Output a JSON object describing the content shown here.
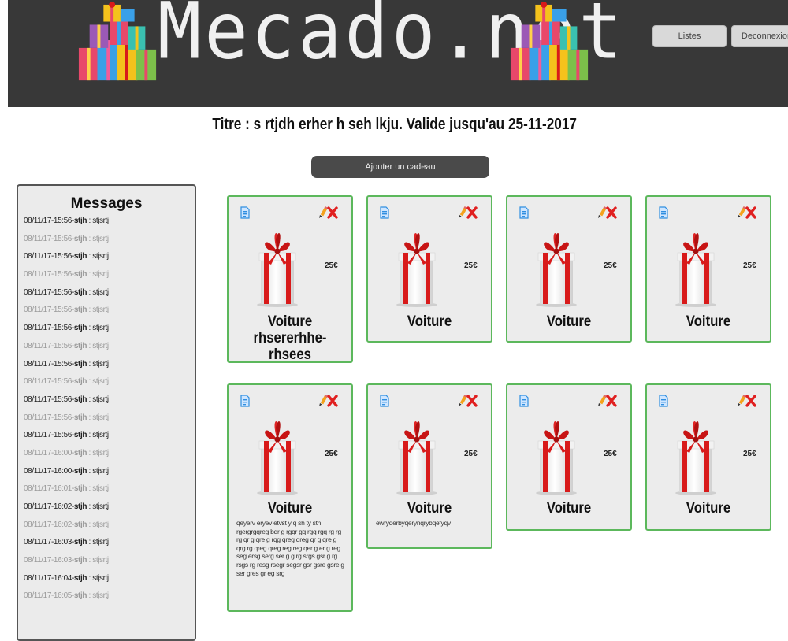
{
  "header": {
    "logo_text": "Mecado.net",
    "buttons": {
      "listes": "Listes",
      "deconnexion": "Deconnexion"
    }
  },
  "page_title": "Titre : s rtjdh erher h seh lkju. Valide jusqu'au 25-11-2017",
  "add_button": "Ajouter un cadeau",
  "messages": {
    "title": "Messages",
    "items": [
      {
        "time": "08/11/17-15:56",
        "user": "stjh",
        "text": " : stjsrtj"
      },
      {
        "time": "08/11/17-15:56",
        "user": "stjh",
        "text": " : stjsrtj"
      },
      {
        "time": "08/11/17-15:56",
        "user": "stjh",
        "text": " : stjsrtj"
      },
      {
        "time": "08/11/17-15:56",
        "user": "stjh",
        "text": " : stjsrtj"
      },
      {
        "time": "08/11/17-15:56",
        "user": "stjh",
        "text": " : stjsrtj"
      },
      {
        "time": "08/11/17-15:56",
        "user": "stjh",
        "text": " : stjsrtj"
      },
      {
        "time": "08/11/17-15:56",
        "user": "stjh",
        "text": " : stjsrtj"
      },
      {
        "time": "08/11/17-15:56",
        "user": "stjh",
        "text": " : stjsrtj"
      },
      {
        "time": "08/11/17-15:56",
        "user": "stjh",
        "text": " : stjsrtj"
      },
      {
        "time": "08/11/17-15:56",
        "user": "stjh",
        "text": " : stjsrtj"
      },
      {
        "time": "08/11/17-15:56",
        "user": "stjh",
        "text": " : stjsrtj"
      },
      {
        "time": "08/11/17-15:56",
        "user": "stjh",
        "text": " : stjsrtj"
      },
      {
        "time": "08/11/17-15:56",
        "user": "stjh",
        "text": " : stjsrtj"
      },
      {
        "time": "08/11/17-16:00",
        "user": "stjh",
        "text": " : stjsrtj"
      },
      {
        "time": "08/11/17-16:00",
        "user": "stjh",
        "text": " : stjsrtj"
      },
      {
        "time": "08/11/17-16:01",
        "user": "stjh",
        "text": " : stjsrtj"
      },
      {
        "time": "08/11/17-16:02",
        "user": "stjh",
        "text": " : stjsrtj"
      },
      {
        "time": "08/11/17-16:02",
        "user": "stjh",
        "text": " : stjsrtj"
      },
      {
        "time": "08/11/17-16:03",
        "user": "stjh",
        "text": " : stjsrtj"
      },
      {
        "time": "08/11/17-16:03",
        "user": "stjh",
        "text": " : stjsrtj"
      },
      {
        "time": "08/11/17-16:04",
        "user": "stjh",
        "text": " : stjsrtj"
      },
      {
        "time": "08/11/17-16:05",
        "user": "stjh",
        "text": " : stjsrtj"
      }
    ]
  },
  "gifts": [
    {
      "name": "Voiture rhsererhhe-rhsees",
      "price": "25€",
      "description": ""
    },
    {
      "name": "Voiture",
      "price": "25€",
      "description": ""
    },
    {
      "name": "Voiture",
      "price": "25€",
      "description": ""
    },
    {
      "name": "Voiture",
      "price": "25€",
      "description": ""
    },
    {
      "name": "Voiture",
      "price": "25€",
      "description": "qeyerv eryev etvst y q sh ty sth rgergrgqreg bqr g rgqr gq rgq rgq rg rg rg qr g qre g rqg qreg qreg qr g qre g qrg rg qreg qreg reg reg qer g er g reg seg ersg serg ser g g rg srgs gsr g rg rsgs rg resg rsegr segsr gsr gsre gsre g ser gres gr eg srg"
    },
    {
      "name": "Voiture",
      "price": "25€",
      "description": "ewryqerbyqerynqrybqefyqv"
    },
    {
      "name": "Voiture",
      "price": "25€",
      "description": ""
    },
    {
      "name": "Voiture",
      "price": "25€",
      "description": ""
    }
  ],
  "icons": {
    "gift": "gift-icon",
    "document": "document-icon",
    "edit": "pencil-icon",
    "delete": "delete-icon"
  },
  "colors": {
    "header_bg": "#383838",
    "card_border": "#5cb85c",
    "card_bg": "#ececec",
    "delete_red": "#e02020",
    "ribbon_red": "#d81a1a"
  }
}
